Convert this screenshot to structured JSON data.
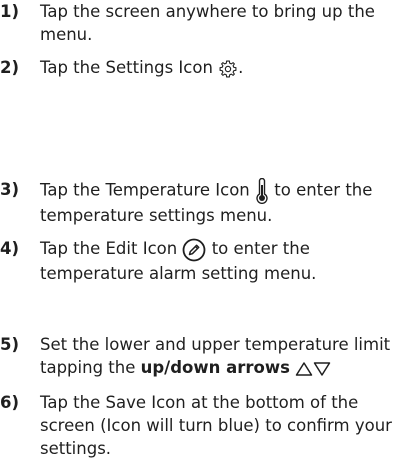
{
  "steps": [
    {
      "number": "1)",
      "text": "Tap the screen anywhere to bring up the menu."
    },
    {
      "number": "2)",
      "text_before": "Tap the Settings Icon",
      "icon": "gear-icon",
      "text_after": "."
    },
    {
      "number": "3)",
      "text_before": "Tap the Temperature Icon",
      "icon": "thermometer-icon",
      "text_after": "to enter the temperature settings menu."
    },
    {
      "number": "4)",
      "text_before": "Tap the Edit Icon",
      "icon": "pencil-circle-icon",
      "text_after": "to enter the temperature alarm setting menu."
    },
    {
      "number": "5)",
      "text_before": "Set the lower and upper temperature limit tapping the",
      "bold_text": "up/down arrows",
      "icons": [
        "triangle-up-icon",
        "triangle-down-icon"
      ]
    },
    {
      "number": "6)",
      "text": "Tap the Save Icon at the bottom of the screen (Icon will turn blue) to confirm your settings."
    }
  ]
}
